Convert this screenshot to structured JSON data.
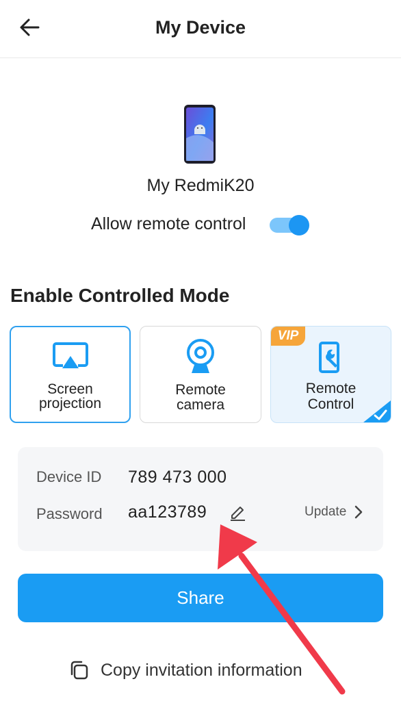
{
  "header": {
    "title": "My Device",
    "back_icon": "arrow-left-icon"
  },
  "device": {
    "name": "My RedmiK20",
    "allow_remote_label": "Allow remote control",
    "allow_remote_on": true
  },
  "section": {
    "title": "Enable Controlled Mode"
  },
  "modes": [
    {
      "line1": "Screen",
      "line2": "projection",
      "icon": "screen-cast-icon",
      "selected": true
    },
    {
      "line1": "Remote",
      "line2": "camera",
      "icon": "webcam-icon",
      "selected": false
    },
    {
      "line1": "Remote",
      "line2": "Control",
      "icon": "phone-wrench-icon",
      "badge": "VIP",
      "checked": true
    }
  ],
  "info": {
    "device_id_label": "Device ID",
    "device_id": "789 473 000",
    "password_label": "Password",
    "password": "aa123789",
    "update_label": "Update"
  },
  "share_label": "Share",
  "copy_label": "Copy invitation information",
  "colors": {
    "accent": "#1a9cf3",
    "vip": "#f6a53a",
    "annotation": "#f03a4a"
  }
}
